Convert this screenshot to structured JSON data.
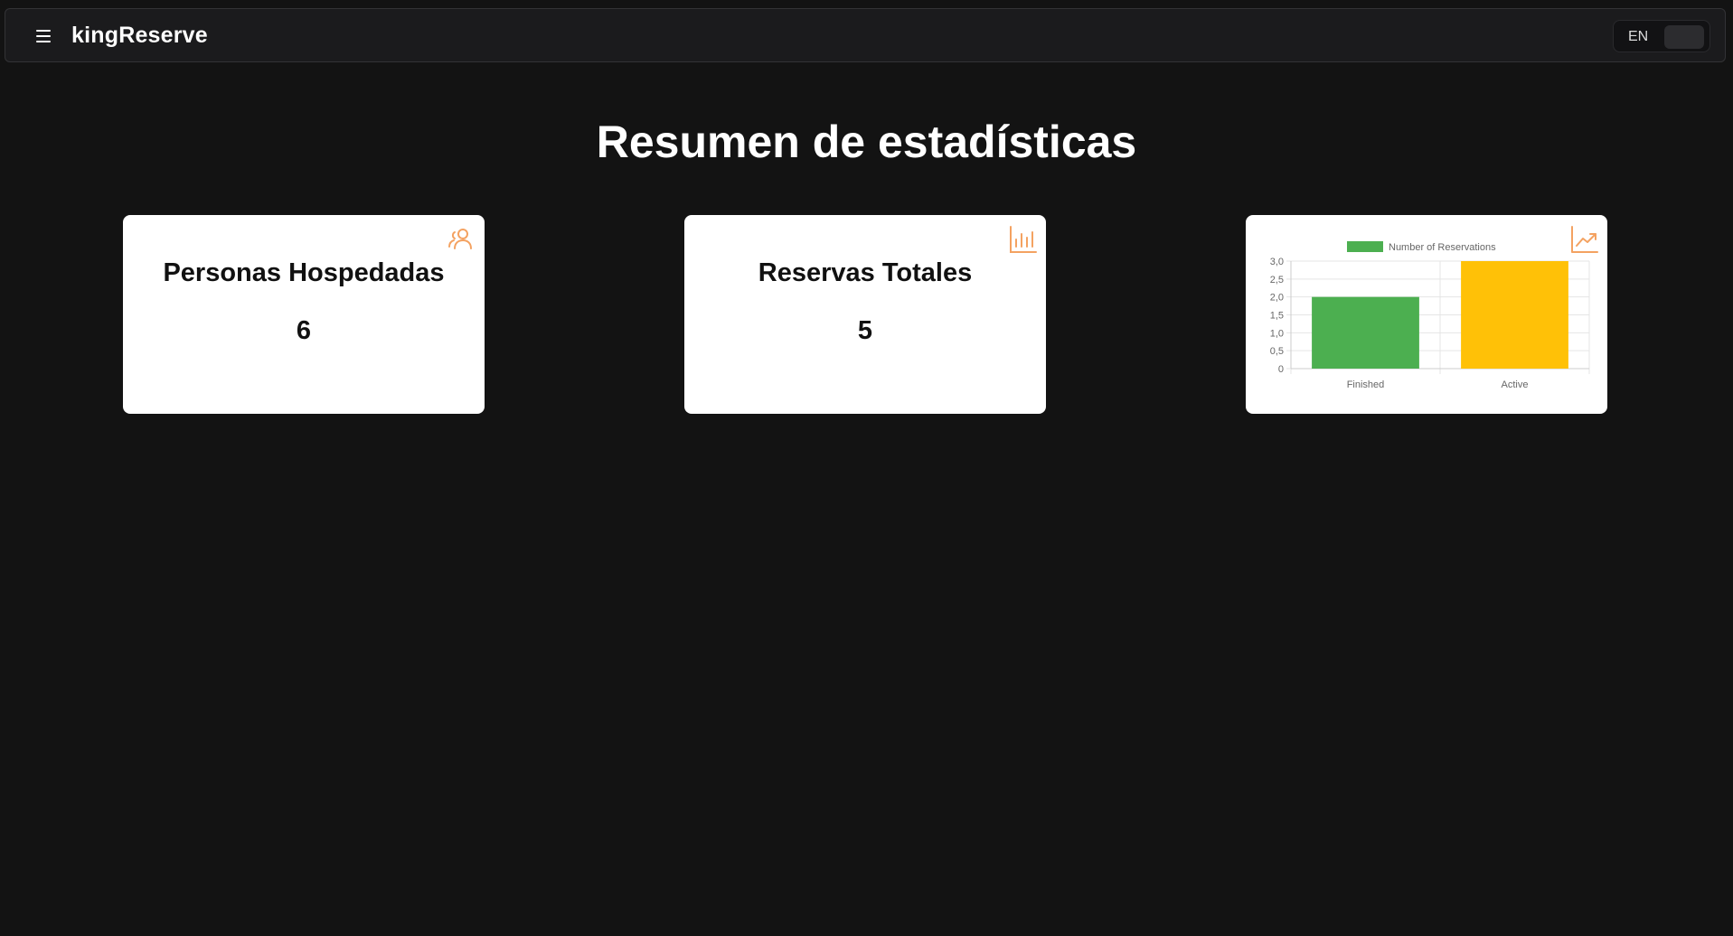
{
  "header": {
    "brand": "kingReserve",
    "language": "EN"
  },
  "main": {
    "title": "Resumen de estadísticas",
    "cards": [
      {
        "title": "Personas Hospedadas",
        "value": "6",
        "icon": "users-icon"
      },
      {
        "title": "Reservas Totales",
        "value": "5",
        "icon": "bar-chart-icon"
      }
    ],
    "chart_card": {
      "icon": "trending-up-icon"
    }
  },
  "colors": {
    "background": "#131313",
    "accent": "#f4a261",
    "finished": "#4caf50",
    "active": "#ffc107"
  },
  "chart_data": {
    "type": "bar",
    "categories": [
      "Finished",
      "Active"
    ],
    "series": [
      {
        "name": "Number of Reservations",
        "values": [
          2,
          3
        ]
      }
    ],
    "bar_colors": [
      "#4caf50",
      "#ffc107"
    ],
    "ylim": [
      0,
      3
    ],
    "yticks": [
      "0",
      "0,5",
      "1,0",
      "1,5",
      "2,0",
      "2,5",
      "3,0"
    ],
    "legend": "top",
    "grid": true
  }
}
